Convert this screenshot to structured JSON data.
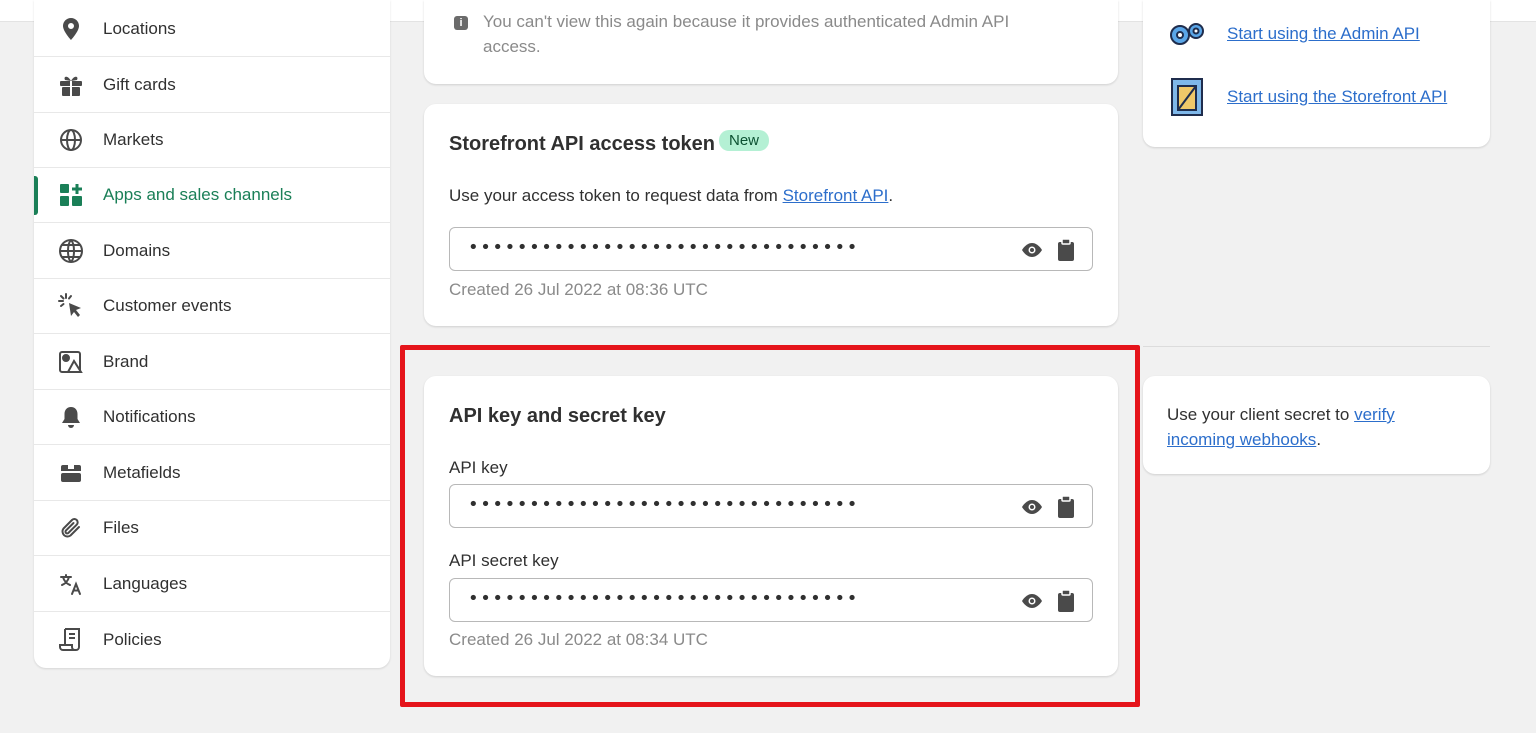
{
  "sidebar": {
    "items": [
      {
        "label": "Locations",
        "icon": "location-pin-icon",
        "active": false
      },
      {
        "label": "Gift cards",
        "icon": "gift-icon",
        "active": false
      },
      {
        "label": "Markets",
        "icon": "globe-markets-icon",
        "active": false
      },
      {
        "label": "Apps and sales channels",
        "icon": "apps-icon",
        "active": true
      },
      {
        "label": "Domains",
        "icon": "domains-globe-icon",
        "active": false
      },
      {
        "label": "Customer events",
        "icon": "cursor-click-icon",
        "active": false
      },
      {
        "label": "Brand",
        "icon": "brand-icon",
        "active": false
      },
      {
        "label": "Notifications",
        "icon": "bell-icon",
        "active": false
      },
      {
        "label": "Metafields",
        "icon": "metafields-icon",
        "active": false
      },
      {
        "label": "Files",
        "icon": "paperclip-icon",
        "active": false
      },
      {
        "label": "Languages",
        "icon": "translate-icon",
        "active": false
      },
      {
        "label": "Policies",
        "icon": "policy-scroll-icon",
        "active": false
      }
    ]
  },
  "admin_card": {
    "note_line1": "You can't view this again because it provides authenticated Admin API",
    "note_line2": "access."
  },
  "storefront_card": {
    "title": "Storefront API access token",
    "badge": "New",
    "description_prefix": "Use your access token to request data from ",
    "description_link": "Storefront API",
    "description_suffix": ".",
    "token_masked": "••••••••••••••••••••••••••••••••",
    "created": "Created 26 Jul 2022 at 08:36 UTC"
  },
  "keys_card": {
    "title": "API key and secret key",
    "api_key_label": "API key",
    "api_key_masked": "••••••••••••••••••••••••••••••••",
    "secret_label": "API secret key",
    "secret_masked": "••••••••••••••••••••••••••••••••",
    "created": "Created 26 Jul 2022 at 08:34 UTC"
  },
  "resources_card": {
    "admin_link": "Start using the Admin API",
    "storefront_link": "Start using the Storefront API"
  },
  "webhooks_card": {
    "text_prefix": "Use your client secret to ",
    "link_line1": "verify",
    "link_line2": "incoming webhooks",
    "text_suffix": "."
  },
  "colors": {
    "accent_green": "#1a7f57",
    "link_blue": "#2c6ecb",
    "highlight_red": "#e5141b",
    "badge_bg": "#b4f0d4"
  }
}
